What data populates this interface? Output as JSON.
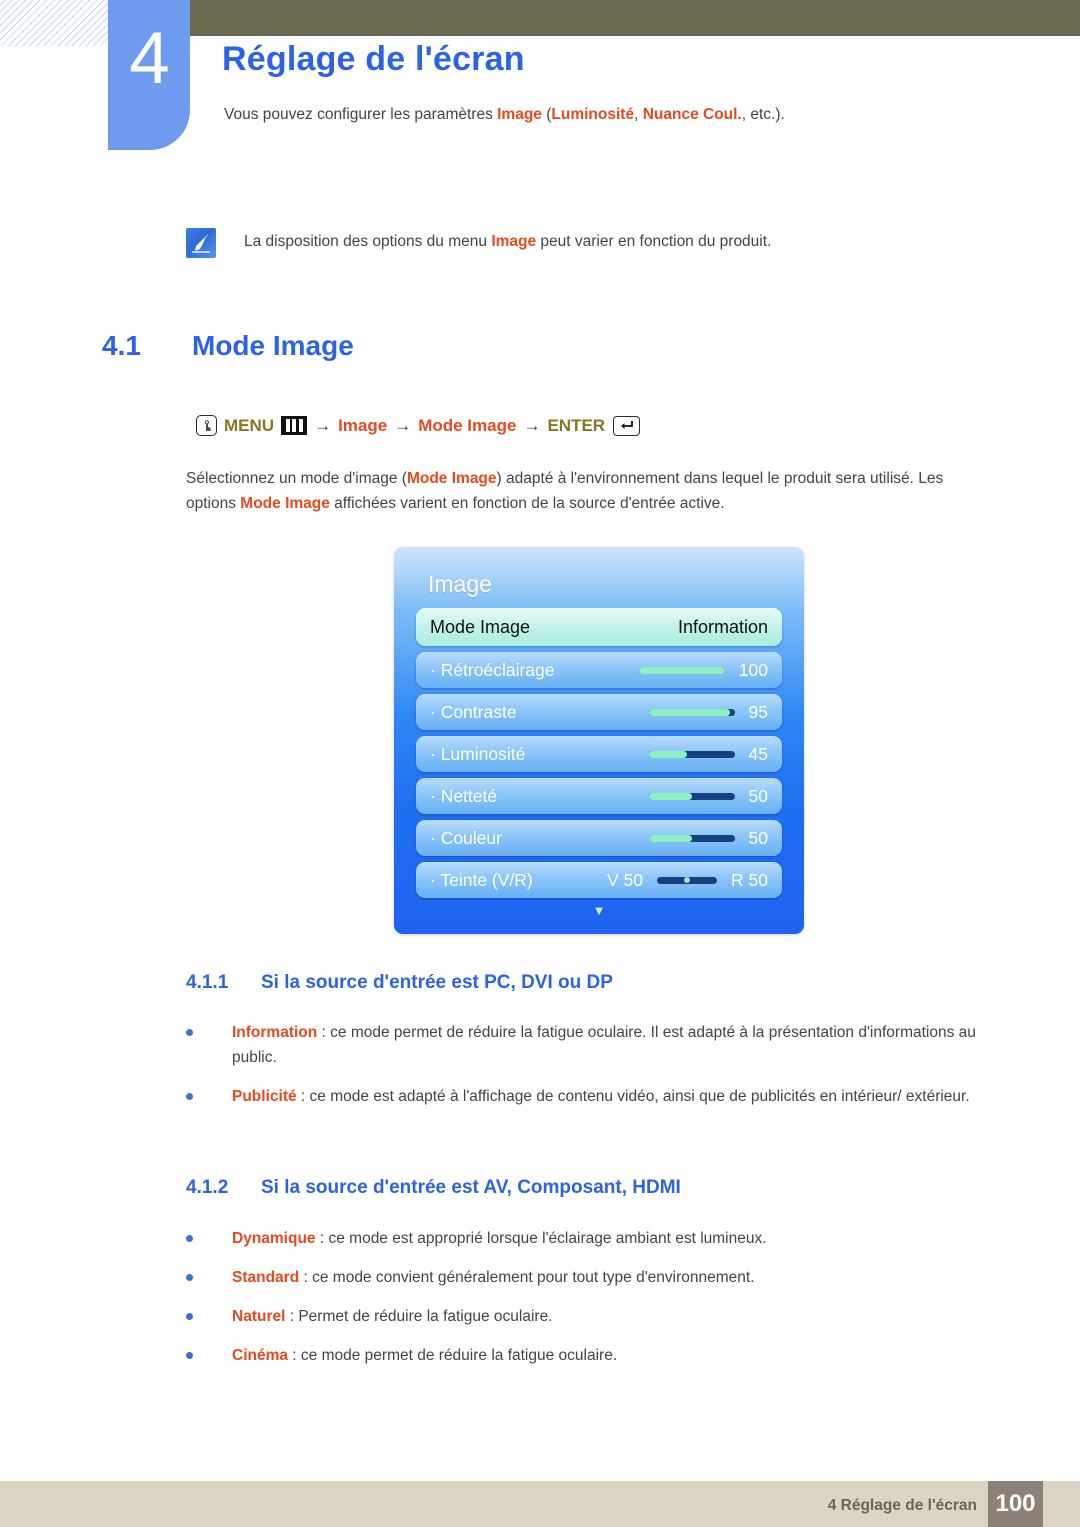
{
  "chapter": {
    "number": "4",
    "title": "Réglage de l'écran",
    "desc_prefix": "Vous pouvez configurer les paramètres ",
    "desc_kw1": "Image",
    "desc_mid1": " (",
    "desc_kw2": "Luminosité",
    "desc_mid2": ", ",
    "desc_kw3": "Nuance Coul.",
    "desc_suffix": ", etc.)."
  },
  "note": {
    "icon": "note-pen-icon",
    "text_prefix": "La disposition des options du menu ",
    "keyword": "Image",
    "text_suffix": " peut varier en fonction du produit."
  },
  "section": {
    "number": "4.1",
    "title": "Mode Image"
  },
  "menu_path": {
    "press_icon": "finger-press-icon",
    "menu_label": "MENU",
    "grid_icon": "menu-grid-icon",
    "arrow": "→",
    "step1": "Image",
    "step2": "Mode Image",
    "enter_label": "ENTER",
    "enter_icon": "enter-return-icon"
  },
  "body": {
    "p1_a": "Sélectionnez un mode d'image (",
    "p1_kw1": "Mode Image",
    "p1_b": ") adapté à l'environnement dans lequel le produit sera utilisé. Les options ",
    "p1_kw2": "Mode Image",
    "p1_c": " affichées varient en fonction de la source d'entrée active."
  },
  "osd": {
    "title": "Image",
    "caret_icon": "chevron-down-icon",
    "rows": [
      {
        "label": "Mode Image",
        "value": "Information",
        "selected": true,
        "slider": null
      },
      {
        "label": "· Rétroéclairage",
        "value": "100",
        "selected": false,
        "slider": {
          "type": "bar",
          "fill_pct": 100
        }
      },
      {
        "label": "· Contraste",
        "value": "95",
        "selected": false,
        "slider": {
          "type": "bar",
          "fill_pct": 95
        }
      },
      {
        "label": "· Luminosité",
        "value": "45",
        "selected": false,
        "slider": {
          "type": "bar",
          "fill_pct": 45
        }
      },
      {
        "label": "· Netteté",
        "value": "50",
        "selected": false,
        "slider": {
          "type": "bar",
          "fill_pct": 50
        }
      },
      {
        "label": "· Couleur",
        "value": "50",
        "selected": false,
        "slider": {
          "type": "bar",
          "fill_pct": 50
        }
      },
      {
        "label": "· Teinte (V/R)",
        "value": "R 50",
        "left_value": "V 50",
        "selected": false,
        "slider": {
          "type": "centered",
          "fill_pct": 50
        }
      }
    ]
  },
  "subsection1": {
    "number": "4.1.1",
    "title": "Si la source d'entrée est PC, DVI ou DP",
    "bullets": [
      {
        "term": "Information",
        "desc": " : ce mode permet de réduire la fatigue oculaire. Il est adapté à la présentation d'informations au public."
      },
      {
        "term": "Publicité",
        "desc": " : ce mode est adapté à l'affichage de contenu vidéo, ainsi que de publicités en intérieur/ extérieur."
      }
    ]
  },
  "subsection2": {
    "number": "4.1.2",
    "title": "Si la source d'entrée est AV, Composant, HDMI",
    "bullets": [
      {
        "term": "Dynamique",
        "desc": " : ce mode est approprié lorsque l'éclairage ambiant est lumineux."
      },
      {
        "term": "Standard",
        "desc": " : ce mode convient généralement pour tout type d'environnement."
      },
      {
        "term": "Naturel",
        "desc": " : Permet de réduire la fatigue oculaire."
      },
      {
        "term": "Cinéma",
        "desc": " : ce mode permet de réduire la fatigue oculaire."
      }
    ]
  },
  "footer": {
    "text": "4 Réglage de l'écran",
    "page": "100"
  },
  "colors": {
    "accent_blue": "#2d62e8",
    "badge_blue": "#6f9bef",
    "olive_bar": "#6b6950",
    "keyword_orange": "#e8491d",
    "keyword_olive": "#8a7520",
    "footer_bar": "#dcd4c4",
    "footer_page_box": "#8d8177",
    "osd_slider_fill": "#8ef0c0",
    "osd_slider_track": "#15427e"
  }
}
